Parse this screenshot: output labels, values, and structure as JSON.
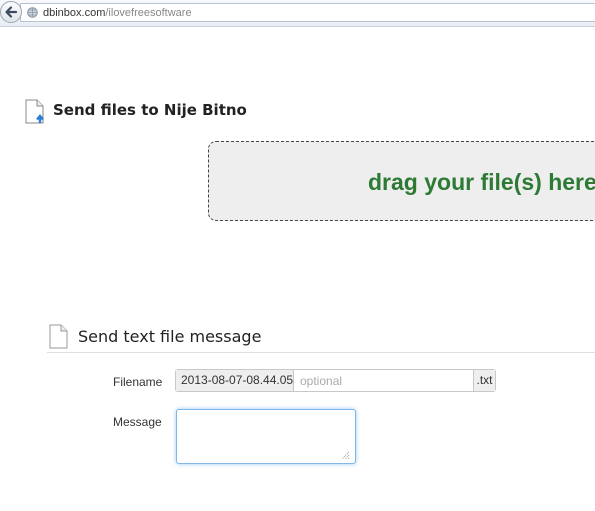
{
  "browser": {
    "url_domain": "dbinbox.com",
    "url_path": "/ilovefreesoftware",
    "back_icon": "back-arrow-icon",
    "site_icon": "globe-icon"
  },
  "upload": {
    "title": "Send files to Nije Bitno",
    "icon": "file-upload-icon",
    "drop_text": "drag your file(s) here"
  },
  "text_message": {
    "title": "Send text file message",
    "icon": "document-icon",
    "filename_label": "Filename",
    "filename_prefix": "2013-08-07-08.44.05",
    "filename_placeholder": "optional",
    "filename_value": "",
    "filename_suffix": ".txt",
    "message_label": "Message",
    "message_value": ""
  },
  "colors": {
    "drop_text": "#2d7a34",
    "focus_border": "#7fb7e6"
  }
}
